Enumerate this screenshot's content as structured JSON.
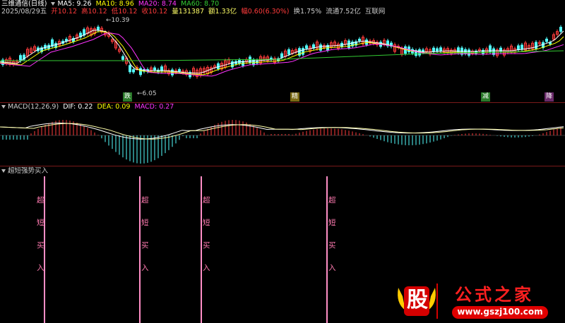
{
  "header": {
    "stock": "三维通信(日线)",
    "ma5": "MA5: 9.26",
    "ma10": "MA10: 8.96",
    "ma20": "MA20: 8.74",
    "ma60": "MA60: 8.70",
    "date": "2025/08/29五",
    "open": "开10.12",
    "high": "高10.12",
    "low": "低10.12",
    "close": "收10.12",
    "volume": "量131387",
    "amount": "额1.33亿",
    "change": "幅0.60(6.30%)",
    "turnover": "换1.75%",
    "float": "流通7.52亿",
    "sector": "互联网"
  },
  "price_labels": {
    "high": "10.39",
    "low": "6.05"
  },
  "badges": {
    "b1": "跌",
    "b2": "精",
    "b3": "减",
    "b4": "降"
  },
  "macd": {
    "title": "MACD(12,26,9)",
    "dif": "DIF: 0.22",
    "dea": "DEA: 0.09",
    "macd": "MACD: 0.27"
  },
  "signal": {
    "title": "超短强势买入",
    "chars": [
      "超",
      "短",
      "买",
      "入"
    ]
  },
  "logo": {
    "big": "股",
    "name": "公式之家",
    "url": "www.gszj100.com"
  },
  "colors": {
    "up": "#ff3b3b",
    "down": "#54ffff",
    "ma5": "#ffffff",
    "ma10": "#ffff00",
    "ma20": "#ff33ff",
    "ma60": "#33cc33"
  }
}
